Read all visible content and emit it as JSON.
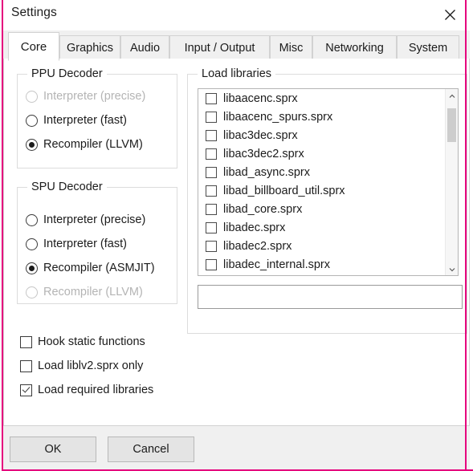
{
  "window": {
    "title": "Settings",
    "close_icon": "close-icon"
  },
  "tabs": [
    {
      "label": "Core",
      "active": true
    },
    {
      "label": "Graphics",
      "active": false
    },
    {
      "label": "Audio",
      "active": false
    },
    {
      "label": "Input / Output",
      "active": false
    },
    {
      "label": "Misc",
      "active": false
    },
    {
      "label": "Networking",
      "active": false
    },
    {
      "label": "System",
      "active": false
    }
  ],
  "ppu_decoder": {
    "title": "PPU Decoder",
    "options": [
      {
        "label": "Interpreter (precise)",
        "checked": false,
        "disabled": true
      },
      {
        "label": "Interpreter (fast)",
        "checked": false,
        "disabled": false
      },
      {
        "label": "Recompiler (LLVM)",
        "checked": true,
        "disabled": false
      }
    ]
  },
  "spu_decoder": {
    "title": "SPU Decoder",
    "options": [
      {
        "label": "Interpreter (precise)",
        "checked": false,
        "disabled": false
      },
      {
        "label": "Interpreter (fast)",
        "checked": false,
        "disabled": false
      },
      {
        "label": "Recompiler (ASMJIT)",
        "checked": true,
        "disabled": false
      },
      {
        "label": "Recompiler (LLVM)",
        "checked": false,
        "disabled": true
      }
    ]
  },
  "load_libraries": {
    "title": "Load libraries",
    "items": [
      {
        "label": "libaacenc.sprx",
        "checked": false
      },
      {
        "label": "libaacenc_spurs.sprx",
        "checked": false
      },
      {
        "label": "libac3dec.sprx",
        "checked": false
      },
      {
        "label": "libac3dec2.sprx",
        "checked": false
      },
      {
        "label": "libad_async.sprx",
        "checked": false
      },
      {
        "label": "libad_billboard_util.sprx",
        "checked": false
      },
      {
        "label": "libad_core.sprx",
        "checked": false
      },
      {
        "label": "libadec.sprx",
        "checked": false
      },
      {
        "label": "libadec2.sprx",
        "checked": false
      },
      {
        "label": "libadec_internal.sprx",
        "checked": false
      }
    ],
    "filter": {
      "value": "",
      "placeholder": ""
    },
    "scrollbar": {
      "up_icon": "chevron-up-icon",
      "down_icon": "chevron-down-icon"
    }
  },
  "options": [
    {
      "label": "Hook static functions",
      "checked": false
    },
    {
      "label": "Load liblv2.sprx only",
      "checked": false
    },
    {
      "label": "Load required libraries",
      "checked": true
    }
  ],
  "footer": {
    "ok_label": "OK",
    "cancel_label": "Cancel"
  },
  "colors": {
    "accent_edge": "#e5007d",
    "tab_bar": "#f0f0f0",
    "button_face": "#e4e4e4",
    "text": "#1b1b1b",
    "disabled_text": "#b4b4b4"
  }
}
